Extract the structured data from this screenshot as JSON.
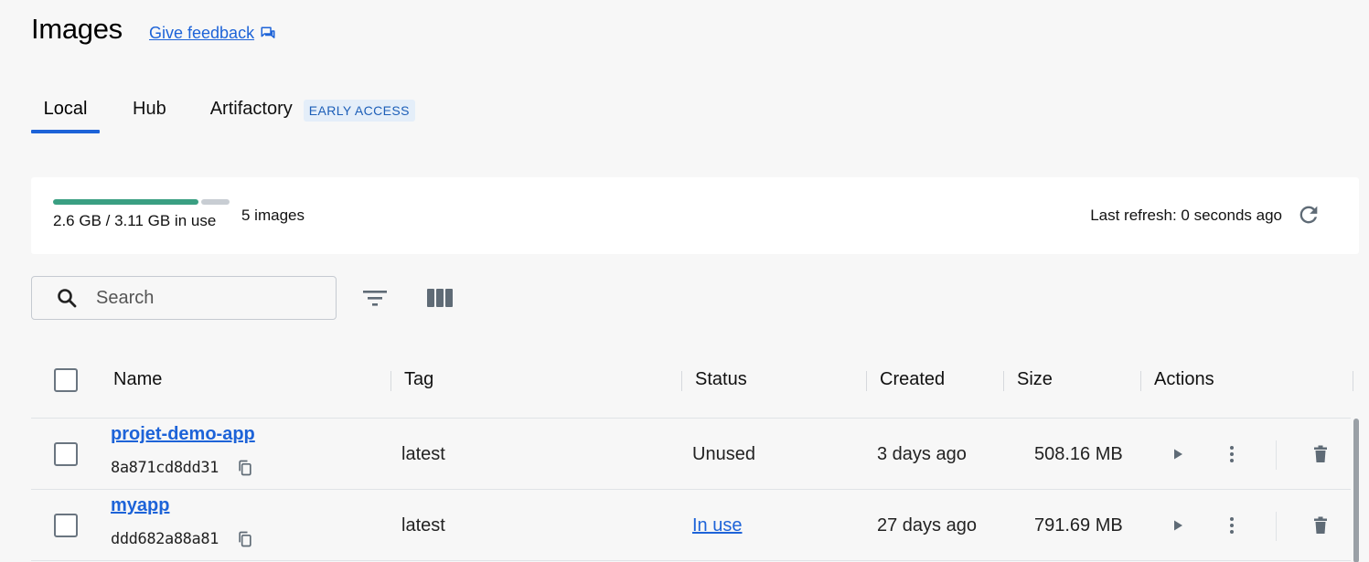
{
  "header": {
    "title": "Images",
    "feedback_label": "Give feedback"
  },
  "tabs": [
    {
      "label": "Local",
      "active": true
    },
    {
      "label": "Hub",
      "active": false
    },
    {
      "label": "Artifactory",
      "active": false,
      "badge": "EARLY ACCESS"
    }
  ],
  "usage": {
    "text": "2.6 GB / 3.11 GB in use",
    "used_fraction": 0.836,
    "images_count": "5 images",
    "last_refresh": "Last refresh: 0 seconds ago"
  },
  "toolbar": {
    "search_placeholder": "Search"
  },
  "table": {
    "columns": [
      "Name",
      "Tag",
      "Status",
      "Created",
      "Size",
      "Actions"
    ],
    "rows": [
      {
        "name": "projet-demo-app",
        "id": "8a871cd8dd31",
        "tag": "latest",
        "status": "Unused",
        "created": "3 days ago",
        "size": "508.16 MB"
      },
      {
        "name": "myapp",
        "id": "ddd682a88a81",
        "tag": "latest",
        "status": "In use",
        "created": "27 days ago",
        "size": "791.69 MB"
      }
    ]
  },
  "colors": {
    "accent": "#1d63d8",
    "usage_used": "#3a9f82",
    "usage_free": "#c8cdd3"
  }
}
